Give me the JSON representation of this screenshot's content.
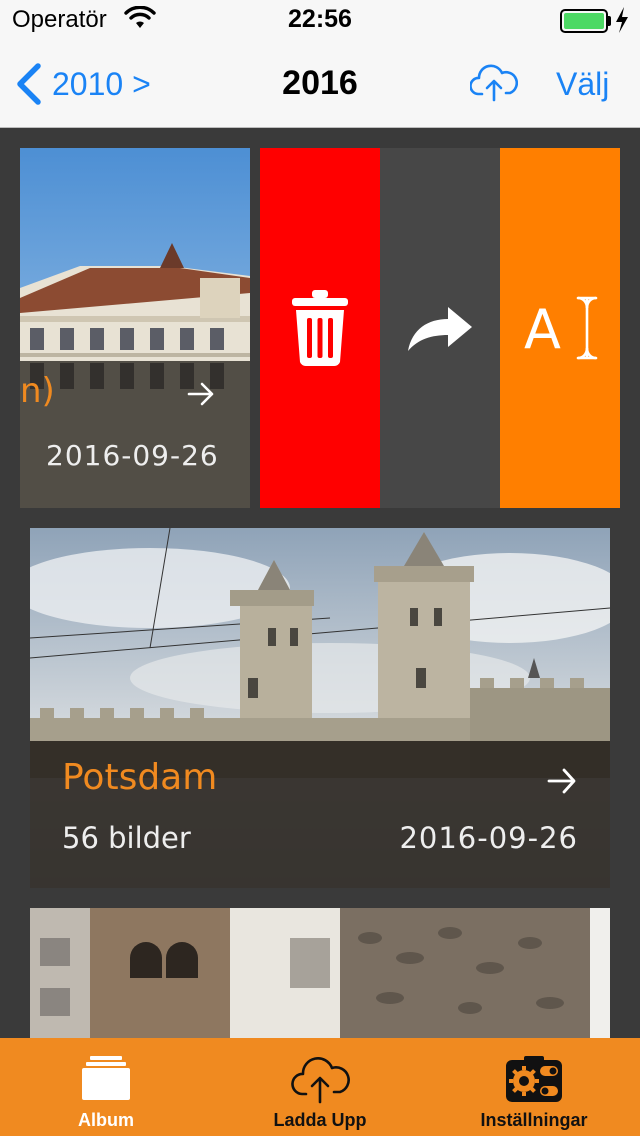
{
  "statusbar": {
    "carrier": "Operatör",
    "time": "22:56",
    "battery_level": 1.0
  },
  "nav": {
    "back_label": "2010 >",
    "title": "2016",
    "select_label": "Välj",
    "cloud_icon": "cloud-upload-icon"
  },
  "albums": [
    {
      "partial_title": "n)",
      "date": "2016-09-26"
    },
    {
      "title": "Potsdam",
      "count": "56 bilder",
      "date": "2016-09-26"
    }
  ],
  "swipe_actions": [
    {
      "icon": "trash-icon",
      "color": "#ff0000"
    },
    {
      "icon": "share-arrow-icon",
      "color": "#474747"
    },
    {
      "icon": "rename-text-icon",
      "color": "#ff7f00",
      "label": "A"
    }
  ],
  "tabbar": {
    "accent": "#f08a20",
    "tabs": [
      {
        "label": "Album",
        "icon": "album-stack-icon",
        "selected": true
      },
      {
        "label": "Ladda Upp",
        "icon": "cloud-upload-icon",
        "selected": false
      },
      {
        "label": "Inställningar",
        "icon": "settings-toggle-icon",
        "selected": false
      }
    ]
  }
}
